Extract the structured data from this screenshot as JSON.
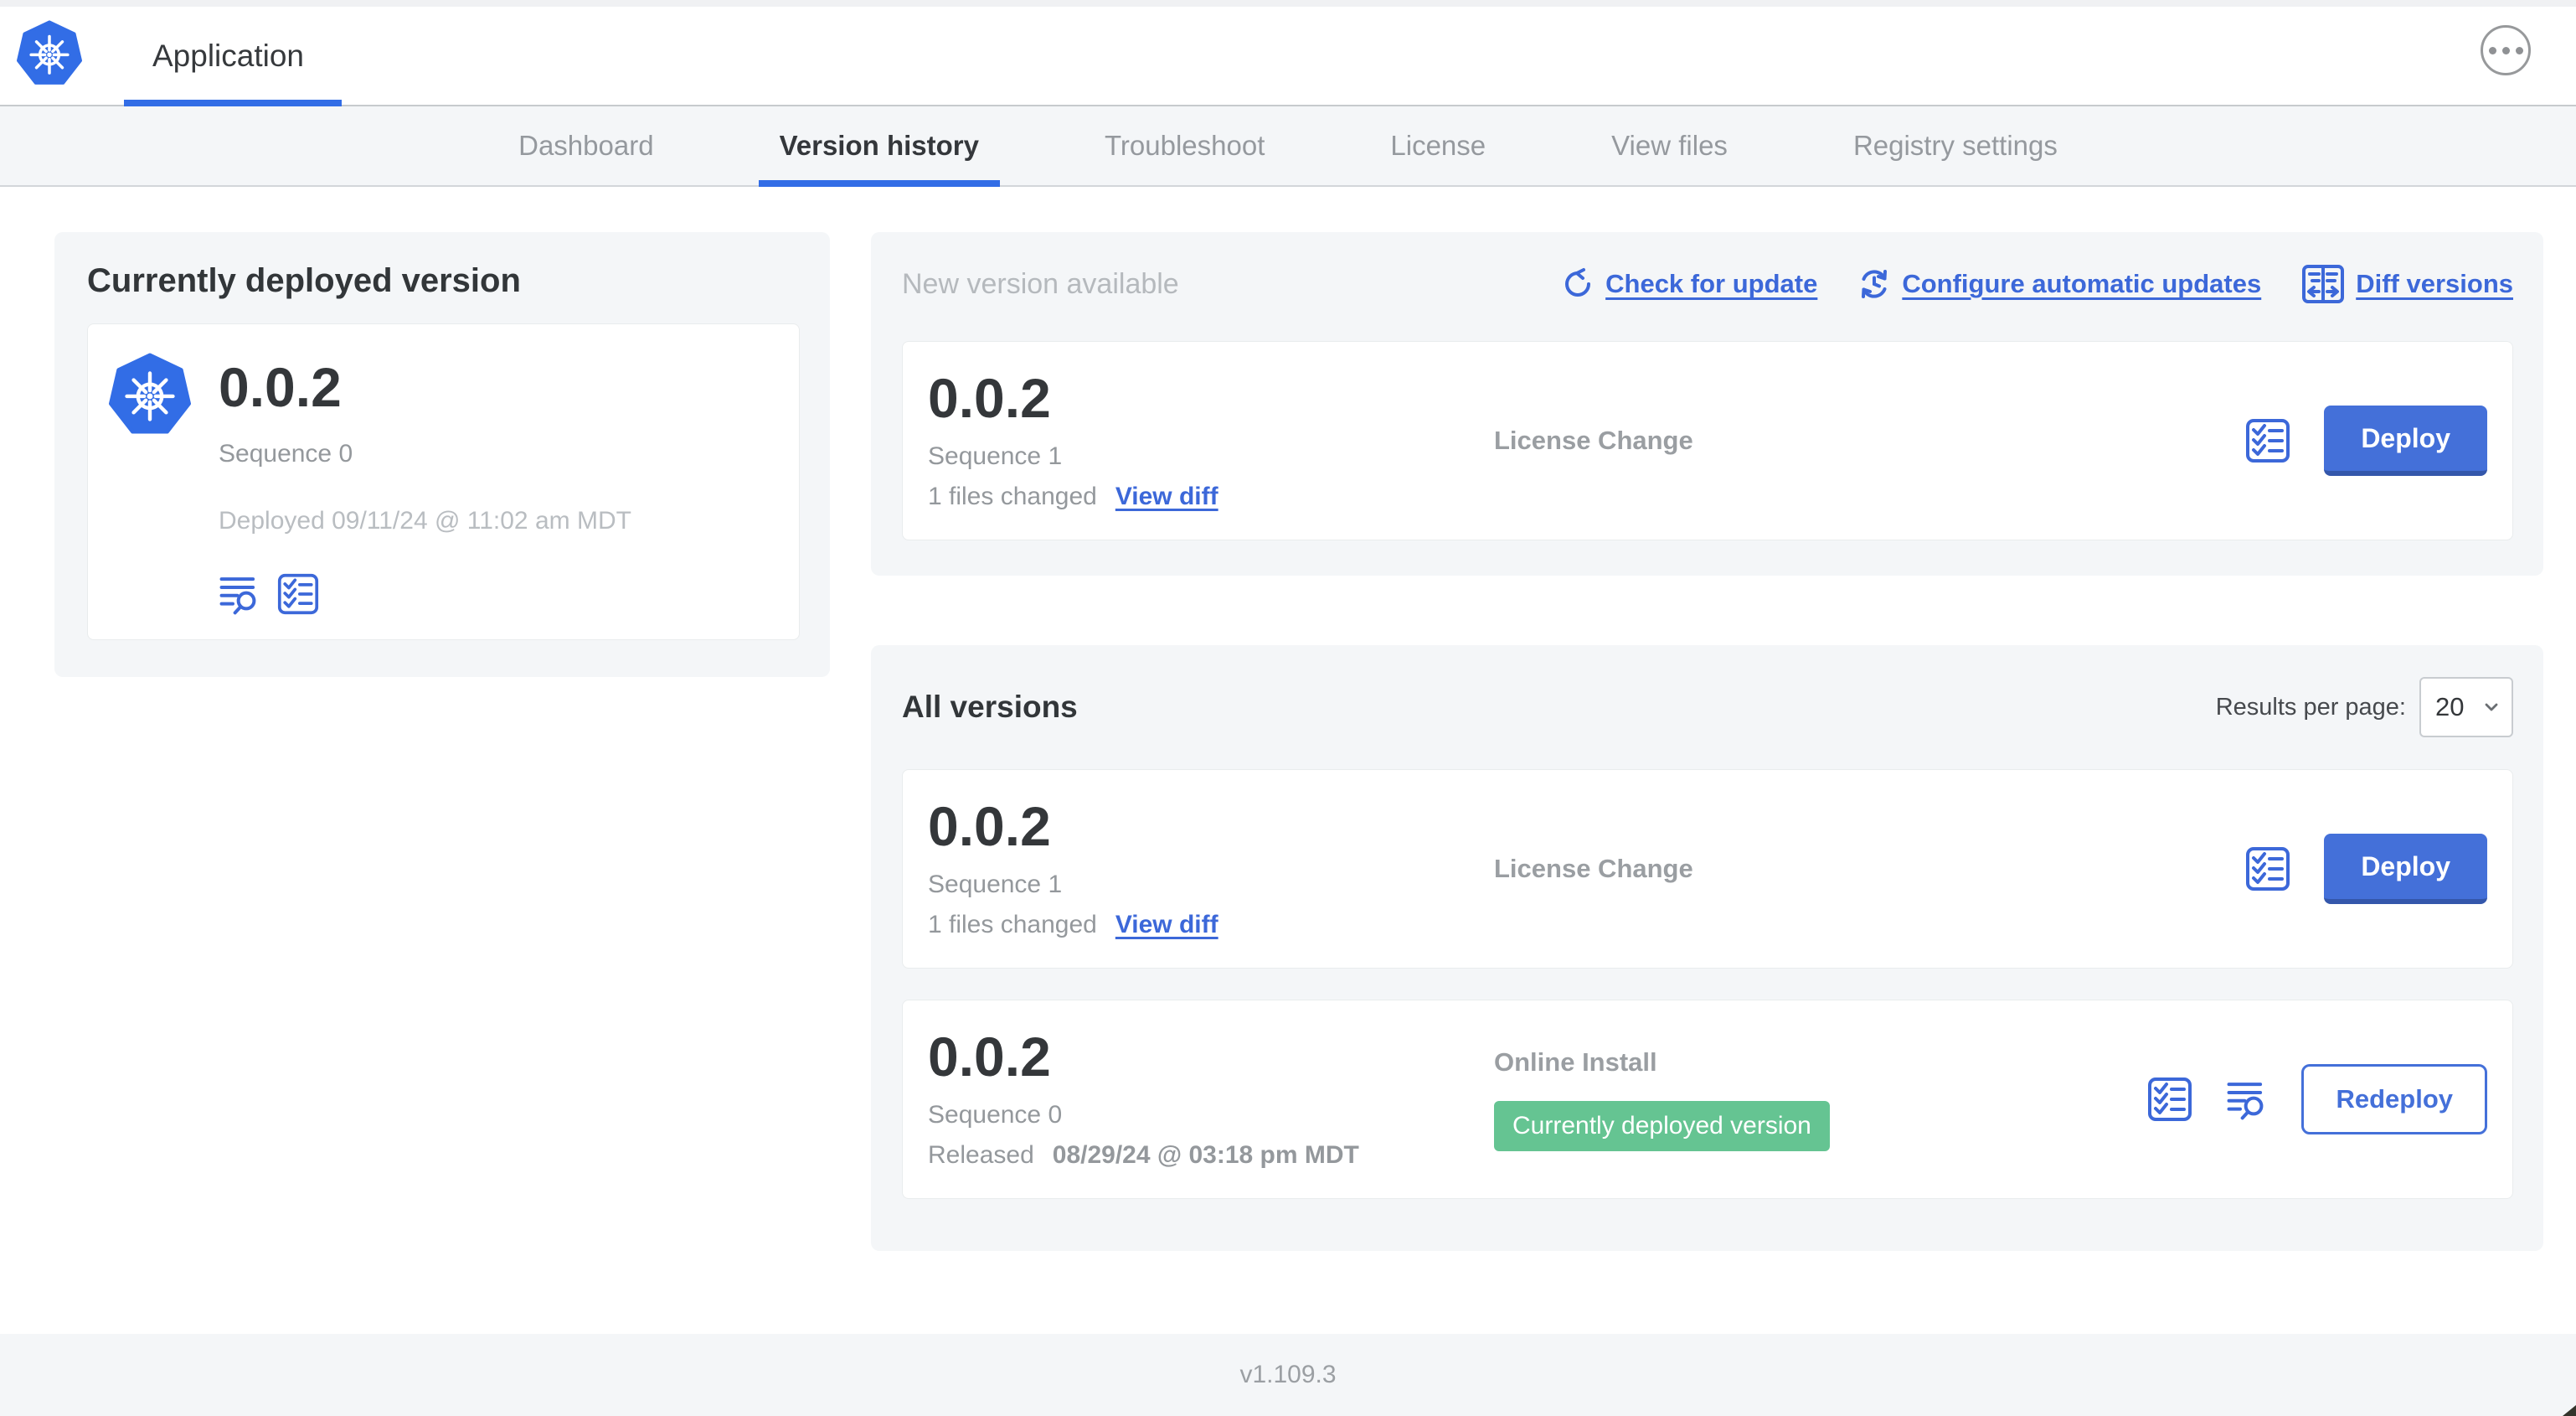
{
  "header": {
    "app_title": "Application",
    "menu_icon": "ellipsis-circle"
  },
  "nav": {
    "active_tab": "Version history",
    "tabs": [
      {
        "label": "Dashboard",
        "active": false
      },
      {
        "label": "Version history",
        "active": true
      },
      {
        "label": "Troubleshoot",
        "active": false
      },
      {
        "label": "License",
        "active": false
      },
      {
        "label": "View files",
        "active": false
      },
      {
        "label": "Registry settings",
        "active": false
      }
    ]
  },
  "current_version": {
    "title": "Currently deployed version",
    "version": "0.0.2",
    "sequence": "Sequence 0",
    "deployed": "Deployed 09/11/24 @ 11:02 am MDT"
  },
  "new_version": {
    "heading": "New version available",
    "actions": [
      {
        "label": "Check for update",
        "icon": "refresh-arrow"
      },
      {
        "label": "Configure automatic updates",
        "icon": "clock-refresh"
      },
      {
        "label": "Diff versions",
        "icon": "split-diff"
      }
    ],
    "card": {
      "version": "0.0.2",
      "sequence": "Sequence 1",
      "files_changed": "1 files changed",
      "view_diff": "View diff",
      "source": "License Change",
      "action": "Deploy"
    }
  },
  "all_versions": {
    "title": "All versions",
    "results_per_page_label": "Results per page:",
    "results_per_page_value": "20",
    "rows": [
      {
        "version": "0.0.2",
        "sequence": "Sequence 1",
        "files_changed": "1 files changed",
        "view_diff": "View diff",
        "source": "License Change",
        "action": "Deploy"
      },
      {
        "version": "0.0.2",
        "sequence": "Sequence 0",
        "released_prefix": "Released",
        "released_date": "08/29/24 @ 03:18 pm MDT",
        "source": "Online Install",
        "badge": "Currently deployed version",
        "action": "Redeploy"
      }
    ]
  },
  "footer": {
    "app_version": "v1.109.3"
  },
  "icons": {
    "app_logo": "kubernetes-helm-wheel",
    "overflow_menu": "ellipsis-circle",
    "check_for_update": "refresh-arrow",
    "configure_updates": "clock-refresh",
    "diff_versions": "split-diff",
    "release_notes": "lines-magnifier",
    "preflight_checks": "checklist",
    "select_chevron": "chevron-down"
  },
  "colors": {
    "accent_blue": "#326de6",
    "link_blue": "#3c68d9",
    "button_blue": "#4470d9",
    "button_blue_shadow": "#3457ab",
    "badge_green": "#65c492",
    "panel_gray": "#f4f6f8",
    "text_dark": "#323639",
    "text_gray": "#94989c",
    "text_light_gray": "#b9bdc1"
  }
}
